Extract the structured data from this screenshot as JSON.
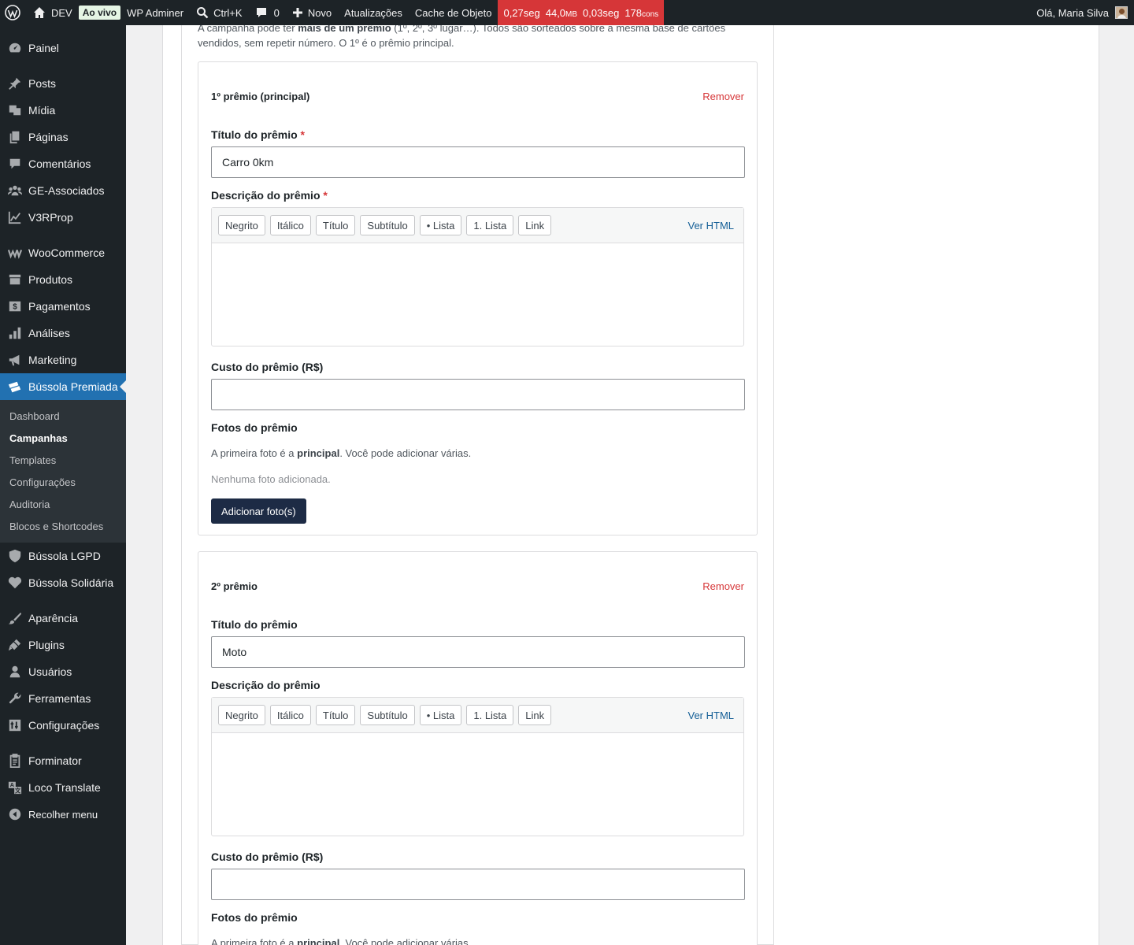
{
  "adminbar": {
    "site": "DEV",
    "live_badge": "Ao vivo",
    "adminer": "WP Adminer",
    "search": "Ctrl+K",
    "comments_count": "0",
    "new": "Novo",
    "updates": "Atualizações",
    "cache": "Cache de Objeto",
    "perf": {
      "time1": "0,27seg",
      "mem": "44,0",
      "mem_unit": "MB",
      "time2": "0,03seg",
      "queries": "178",
      "queries_unit": "cons"
    },
    "greeting": "Olá, Maria Silva"
  },
  "sidebar": {
    "items": [
      {
        "label": "Painel",
        "icon": "dashboard-icon"
      },
      {
        "label": "Posts",
        "icon": "pin-icon"
      },
      {
        "label": "Mídia",
        "icon": "media-icon"
      },
      {
        "label": "Páginas",
        "icon": "pages-icon"
      },
      {
        "label": "Comentários",
        "icon": "comment-icon"
      },
      {
        "label": "GE-Associados",
        "icon": "groups-icon"
      },
      {
        "label": "V3RProp",
        "icon": "chart-line-icon"
      },
      {
        "label": "WooCommerce",
        "icon": "woo-icon"
      },
      {
        "label": "Produtos",
        "icon": "archive-icon"
      },
      {
        "label": "Pagamentos",
        "icon": "payment-icon"
      },
      {
        "label": "Análises",
        "icon": "bar-chart-icon"
      },
      {
        "label": "Marketing",
        "icon": "megaphone-icon"
      },
      {
        "label": "Bússola Premiada",
        "icon": "tickets-icon"
      },
      {
        "label": "Bússola LGPD",
        "icon": "shield-icon"
      },
      {
        "label": "Bússola Solidária",
        "icon": "heart-icon"
      },
      {
        "label": "Aparência",
        "icon": "brush-icon"
      },
      {
        "label": "Plugins",
        "icon": "plugin-icon"
      },
      {
        "label": "Usuários",
        "icon": "user-icon"
      },
      {
        "label": "Ferramentas",
        "icon": "wrench-icon"
      },
      {
        "label": "Configurações",
        "icon": "settings-icon"
      },
      {
        "label": "Forminator",
        "icon": "clipboard-icon"
      },
      {
        "label": "Loco Translate",
        "icon": "translate-icon"
      },
      {
        "label": "Recolher menu",
        "icon": "collapse-icon"
      }
    ],
    "submenu": [
      "Dashboard",
      "Campanhas",
      "Templates",
      "Configurações",
      "Auditoria",
      "Blocos e Shortcodes"
    ]
  },
  "intro": {
    "pre": "A campanha pode ter ",
    "bold": "mais de um prêmio",
    "post": " (1º, 2º, 3º lugar…). Todos são sorteados sobre a mesma base de cartões vendidos, sem repetir número. O 1º é o prêmio principal."
  },
  "prizes": [
    {
      "heading": "1º prêmio (principal)",
      "remove": "Remover",
      "title_label": "Título do prêmio",
      "title_value": "Carro 0km",
      "desc_label": "Descrição do prêmio",
      "cost_label": "Custo do prêmio (R$)",
      "cost_value": "",
      "photos_label": "Fotos do prêmio",
      "photos_help_pre": "A primeira foto é a ",
      "photos_help_bold": "principal",
      "photos_help_post": ". Você pode adicionar várias.",
      "no_photos": "Nenhuma foto adicionada.",
      "add_photos": "Adicionar foto(s)"
    },
    {
      "heading": "2º prêmio",
      "remove": "Remover",
      "title_label": "Título do prêmio",
      "title_value": "Moto",
      "desc_label": "Descrição do prêmio",
      "cost_label": "Custo do prêmio (R$)",
      "cost_value": "",
      "photos_label": "Fotos do prêmio",
      "photos_help_pre": "A primeira foto é a ",
      "photos_help_bold": "principal",
      "photos_help_post": ". Você pode adicionar várias."
    }
  ],
  "required_mark": "*",
  "editor": {
    "buttons": [
      "Negrito",
      "Itálico",
      "Título",
      "Subtítulo",
      "• Lista",
      "1. Lista",
      "Link"
    ],
    "html_toggle": "Ver HTML"
  },
  "colors": {
    "accent": "#2271b1",
    "danger": "#d63638",
    "primary_button": "#1d2b45",
    "adminbar": "#1d2327"
  }
}
